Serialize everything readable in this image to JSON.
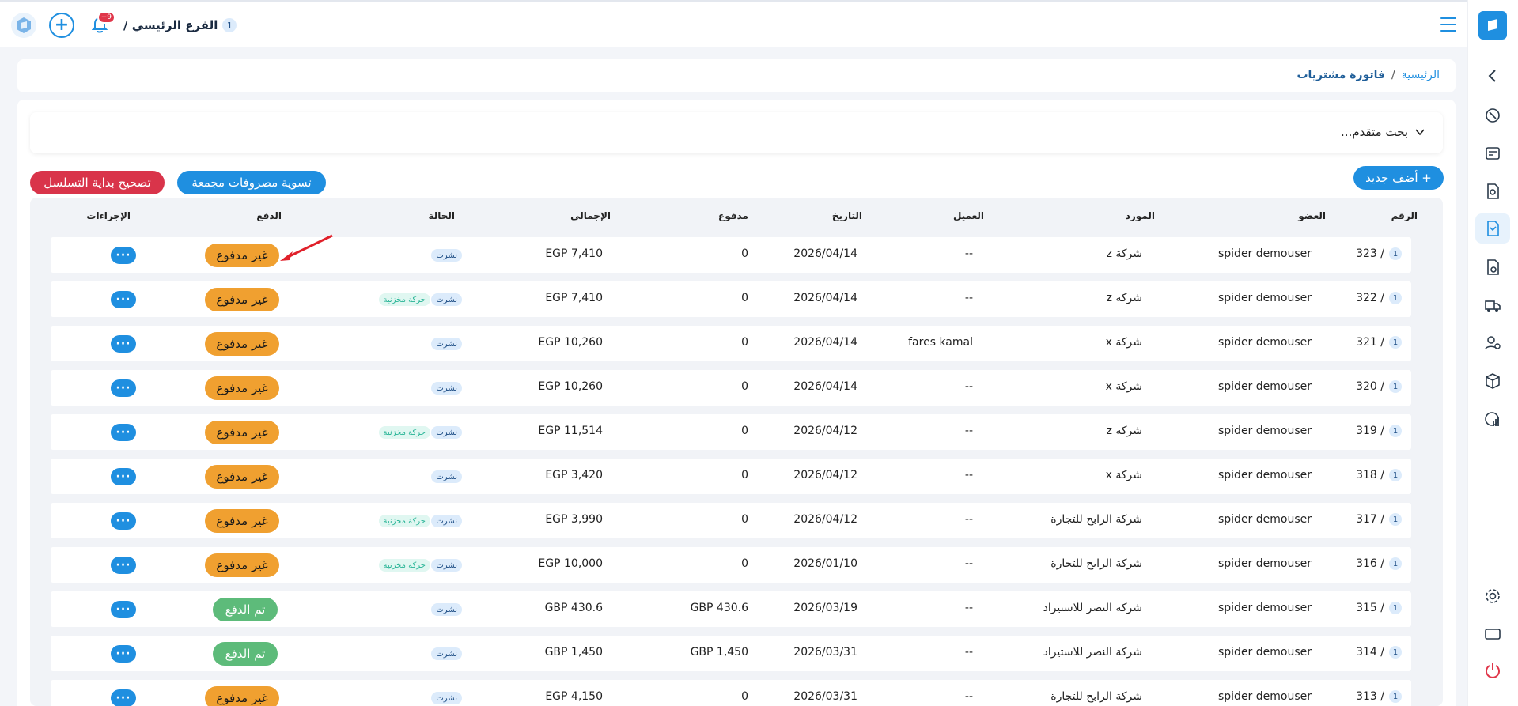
{
  "topbar": {
    "branch_name": "الفرع الرئيسي /",
    "branch_index": "1",
    "notification_count": "+9"
  },
  "breadcrumb": {
    "home": "الرئيسية",
    "separator": "/",
    "current": "فاتورة مشتريات"
  },
  "search": {
    "label": "بحث متقدم..."
  },
  "buttons": {
    "add_new": "+ أضف جديد",
    "settle_expenses": "تسوية مصروفات مجمعة",
    "fix_sequence": "تصحيح بداية التسلسل"
  },
  "table": {
    "headers": {
      "number": "الرقم",
      "member": "العضو",
      "supplier": "المورد",
      "client": "العميل",
      "date": "التاريخ",
      "paid": "مدفوع",
      "total": "الإجمالى",
      "status": "الحالة",
      "payment": "الدفع",
      "actions": "الإجراءات"
    },
    "rows": [
      {
        "num": "323 /",
        "idx": "1",
        "member": "spider demouser",
        "supplier": "شركة z",
        "client": "--",
        "date": "2026/04/14",
        "paid": "0",
        "total": "EGP 7,410",
        "status": "نشرت",
        "inventory": "",
        "payment": "غير مدفوع",
        "paid_state": "unpaid",
        "actions": "···"
      },
      {
        "num": "322 /",
        "idx": "1",
        "member": "spider demouser",
        "supplier": "شركة z",
        "client": "--",
        "date": "2026/04/14",
        "paid": "0",
        "total": "EGP 7,410",
        "status": "نشرت",
        "inventory": "حركة مخزنية",
        "payment": "غير مدفوع",
        "paid_state": "unpaid",
        "actions": "···"
      },
      {
        "num": "321 /",
        "idx": "1",
        "member": "spider demouser",
        "supplier": "شركة x",
        "client": "fares kamal",
        "date": "2026/04/14",
        "paid": "0",
        "total": "EGP 10,260",
        "status": "نشرت",
        "inventory": "",
        "payment": "غير مدفوع",
        "paid_state": "unpaid",
        "actions": "···"
      },
      {
        "num": "320 /",
        "idx": "1",
        "member": "spider demouser",
        "supplier": "شركة x",
        "client": "--",
        "date": "2026/04/14",
        "paid": "0",
        "total": "EGP 10,260",
        "status": "نشرت",
        "inventory": "",
        "payment": "غير مدفوع",
        "paid_state": "unpaid",
        "actions": "···"
      },
      {
        "num": "319 /",
        "idx": "1",
        "member": "spider demouser",
        "supplier": "شركة z",
        "client": "--",
        "date": "2026/04/12",
        "paid": "0",
        "total": "EGP 11,514",
        "status": "نشرت",
        "inventory": "حركة مخزنية",
        "payment": "غير مدفوع",
        "paid_state": "unpaid",
        "actions": "···"
      },
      {
        "num": "318 /",
        "idx": "1",
        "member": "spider demouser",
        "supplier": "شركة x",
        "client": "--",
        "date": "2026/04/12",
        "paid": "0",
        "total": "EGP 3,420",
        "status": "نشرت",
        "inventory": "",
        "payment": "غير مدفوع",
        "paid_state": "unpaid",
        "actions": "···"
      },
      {
        "num": "317 /",
        "idx": "1",
        "member": "spider demouser",
        "supplier": "شركة الرابح للتجارة",
        "client": "--",
        "date": "2026/04/12",
        "paid": "0",
        "total": "EGP 3,990",
        "status": "نشرت",
        "inventory": "حركة مخزنية",
        "payment": "غير مدفوع",
        "paid_state": "unpaid",
        "actions": "···"
      },
      {
        "num": "316 /",
        "idx": "1",
        "member": "spider demouser",
        "supplier": "شركة الرابح للتجارة",
        "client": "--",
        "date": "2026/01/10",
        "paid": "0",
        "total": "EGP 10,000",
        "status": "نشرت",
        "inventory": "حركة مخزنية",
        "payment": "غير مدفوع",
        "paid_state": "unpaid",
        "actions": "···"
      },
      {
        "num": "315 /",
        "idx": "1",
        "member": "spider demouser",
        "supplier": "شركة النصر للاستيراد",
        "client": "--",
        "date": "2026/03/19",
        "paid": "GBP 430.6",
        "total": "GBP 430.6",
        "status": "نشرت",
        "inventory": "",
        "payment": "تم الدفع",
        "paid_state": "paid",
        "actions": "···"
      },
      {
        "num": "314 /",
        "idx": "1",
        "member": "spider demouser",
        "supplier": "شركة النصر للاستيراد",
        "client": "--",
        "date": "2026/03/31",
        "paid": "GBP 1,450",
        "total": "GBP 1,450",
        "status": "نشرت",
        "inventory": "",
        "payment": "تم الدفع",
        "paid_state": "paid",
        "actions": "···"
      },
      {
        "num": "313 /",
        "idx": "1",
        "member": "spider demouser",
        "supplier": "شركة الرابح للتجارة",
        "client": "--",
        "date": "2026/03/31",
        "paid": "0",
        "total": "EGP 4,150",
        "status": "نشرت",
        "inventory": "",
        "payment": "غير مدفوع",
        "paid_state": "unpaid",
        "actions": "···"
      }
    ]
  },
  "colors": {
    "accent": "#1f8fe0",
    "danger": "#d9344a",
    "unpaid": "#f0a030",
    "paid": "#5dbb7a",
    "arrow": "#e0202a"
  },
  "icons": {
    "sidebar": [
      "chevron-left-icon",
      "dashboard-icon",
      "pos-icon",
      "search-document-icon",
      "purchase-invoice-icon",
      "sales-document-icon",
      "shipping-icon",
      "users-settings-icon",
      "inventory-icon",
      "reports-icon",
      "settings-icon",
      "screen-icon",
      "power-icon"
    ]
  }
}
